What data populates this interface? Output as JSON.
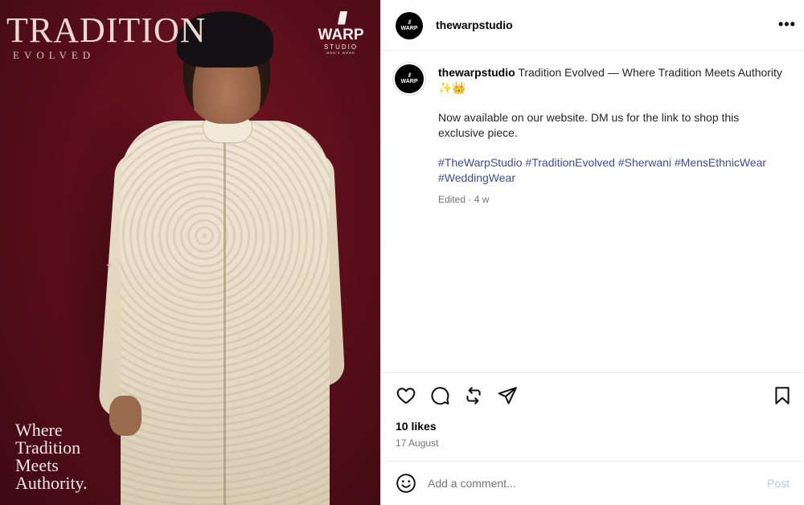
{
  "image": {
    "title": "TRADITION",
    "subtitle": "EVOLVED",
    "brand_word": "WARP",
    "brand_small": "STUDIO",
    "brand_tiny": "MEN'S WEAR",
    "tagline": [
      "Where",
      "Tradition",
      "Meets",
      "Authority."
    ]
  },
  "header": {
    "avatar_text": "WARP",
    "username": "thewarpstudio",
    "more_icon": "more-horizontal-icon"
  },
  "caption": {
    "username": "thewarpstudio",
    "title": "Tradition Evolved — Where Tradition Meets Authority ✨👑",
    "body": "Now available on our website. DM us for the link to shop this exclusive piece.",
    "hashtags": "#TheWarpStudio #TraditionEvolved #Sherwani #MensEthnicWear #WeddingWear",
    "meta": "Edited · 4 w"
  },
  "actions": {
    "likes": "10 likes",
    "date": "17 August",
    "icons": [
      "heart-icon",
      "comment-icon",
      "repost-icon",
      "share-icon",
      "bookmark-icon"
    ]
  },
  "comment": {
    "placeholder": "Add a comment...",
    "post_label": "Post"
  },
  "colors": {
    "background_maroon": "#5c0f1c",
    "hashtag": "#3e4d9a",
    "post_disabled": "#b2c9f0",
    "muted": "#737373"
  }
}
